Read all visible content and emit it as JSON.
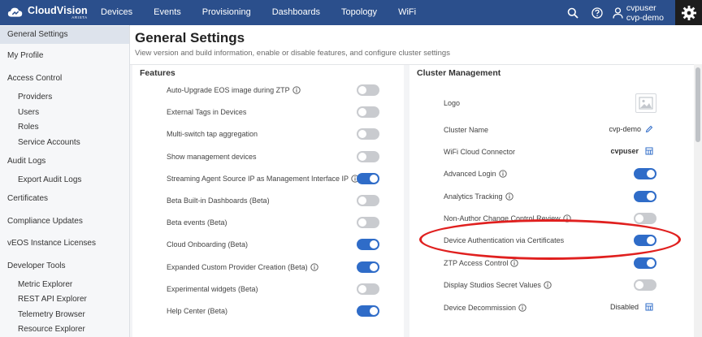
{
  "header": {
    "logo_name": "CloudVision",
    "logo_sub": "ARISTA",
    "nav": [
      "Devices",
      "Events",
      "Provisioning",
      "Dashboards",
      "Topology",
      "WiFi"
    ],
    "user_name": "cvpuser",
    "user_cluster": "cvp-demo"
  },
  "sidebar": {
    "items": [
      {
        "label": "General Settings",
        "level": "main",
        "active": true
      },
      {
        "label": "My Profile",
        "level": "main"
      },
      {
        "label": "Access Control",
        "level": "main"
      },
      {
        "label": "Providers",
        "level": "sub"
      },
      {
        "label": "Users",
        "level": "sub"
      },
      {
        "label": "Roles",
        "level": "sub"
      },
      {
        "label": "Service Accounts",
        "level": "sub"
      },
      {
        "label": "Audit Logs",
        "level": "main"
      },
      {
        "label": "Export Audit Logs",
        "level": "sub"
      },
      {
        "label": "Certificates",
        "level": "main"
      },
      {
        "label": "Compliance Updates",
        "level": "main"
      },
      {
        "label": "vEOS Instance Licenses",
        "level": "main"
      },
      {
        "label": "Developer Tools",
        "level": "main"
      },
      {
        "label": "Metric Explorer",
        "level": "sub"
      },
      {
        "label": "REST API Explorer",
        "level": "sub"
      },
      {
        "label": "Telemetry Browser",
        "level": "sub"
      },
      {
        "label": "Resource Explorer",
        "level": "sub"
      }
    ]
  },
  "page": {
    "title": "General Settings",
    "description": "View version and build information, enable or disable features, and configure cluster settings"
  },
  "features": {
    "title": "Features",
    "rows": [
      {
        "label": "Auto-Upgrade EOS image during ZTP",
        "info": true,
        "on": false
      },
      {
        "label": "External Tags in Devices",
        "info": false,
        "on": false
      },
      {
        "label": "Multi-switch tap aggregation",
        "info": false,
        "on": false
      },
      {
        "label": "Show management devices",
        "info": false,
        "on": false
      },
      {
        "label": "Streaming Agent Source IP as Management Interface IP",
        "info": true,
        "on": true
      },
      {
        "label": "Beta Built-in Dashboards (Beta)",
        "info": false,
        "on": false
      },
      {
        "label": "Beta events (Beta)",
        "info": false,
        "on": false
      },
      {
        "label": "Cloud Onboarding (Beta)",
        "info": false,
        "on": true
      },
      {
        "label": "Expanded Custom Provider Creation (Beta)",
        "info": true,
        "on": true
      },
      {
        "label": "Experimental widgets (Beta)",
        "info": false,
        "on": false
      },
      {
        "label": "Help Center (Beta)",
        "info": false,
        "on": true
      }
    ]
  },
  "cluster": {
    "title": "Cluster Management",
    "rows": [
      {
        "label": "Logo",
        "kind": "logo"
      },
      {
        "label": "Cluster Name",
        "kind": "text",
        "value": "cvp-demo",
        "icon": "pencil-icon"
      },
      {
        "label": "WiFi Cloud Connector",
        "kind": "text",
        "value": "cvpuser",
        "bold": true,
        "icon": "table-icon"
      },
      {
        "label": "Advanced Login",
        "info": true,
        "kind": "toggle",
        "on": true
      },
      {
        "label": "Analytics Tracking",
        "info": true,
        "kind": "toggle",
        "on": true
      },
      {
        "label": "Non-Author Change Control Review",
        "info": true,
        "kind": "toggle",
        "on": false
      },
      {
        "label": "Device Authentication via Certificates",
        "info": false,
        "kind": "toggle",
        "on": true
      },
      {
        "label": "ZTP Access Control",
        "info": true,
        "kind": "toggle",
        "on": true
      },
      {
        "label": "Display Studios Secret Values",
        "info": true,
        "kind": "toggle",
        "on": false
      },
      {
        "label": "Device Decommission",
        "info": true,
        "kind": "text",
        "value": "Disabled",
        "icon": "table-icon"
      }
    ]
  },
  "colors": {
    "header": "#2b4f8c",
    "toggle_on": "#2f6cc8",
    "toggle_off": "#c9cbcf",
    "annotation": "#e0201f"
  }
}
